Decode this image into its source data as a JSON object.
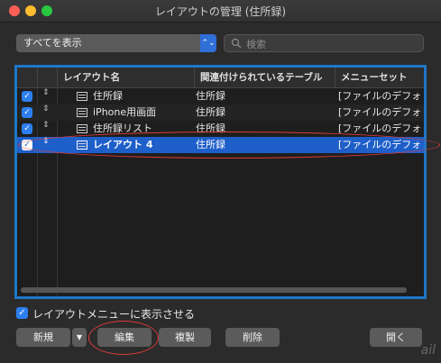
{
  "window": {
    "title": "レイアウトの管理 (住所録)"
  },
  "filter": {
    "selected": "すべてを表示"
  },
  "search": {
    "placeholder": "検索"
  },
  "table": {
    "columns": [
      "レイアウト名",
      "関連付けられているテーブル",
      "メニューセット"
    ],
    "rows": [
      {
        "name": "住所録",
        "table": "住所録",
        "menu": "[ファイルのデフォ"
      },
      {
        "name": "iPhone用画面",
        "table": "住所録",
        "menu": "[ファイルのデフォ"
      },
      {
        "name": "住所録リスト",
        "table": "住所録",
        "menu": "[ファイルのデフォ"
      },
      {
        "name": "レイアウト 4",
        "table": "住所録",
        "menu": "[ファイルのデフォ"
      }
    ]
  },
  "show_in_menu": {
    "label": "レイアウトメニューに表示させる",
    "checked": true
  },
  "buttons": {
    "new": "新規",
    "edit": "編集",
    "duplicate": "複製",
    "delete": "削除",
    "open": "開く"
  },
  "watermark": "ail",
  "icons": {
    "sort": "sort-handle-icon",
    "layout": "layout-icon",
    "search": "search-icon"
  },
  "colors": {
    "accent": "#1e5fc9",
    "annotation": "#e03a3a"
  }
}
